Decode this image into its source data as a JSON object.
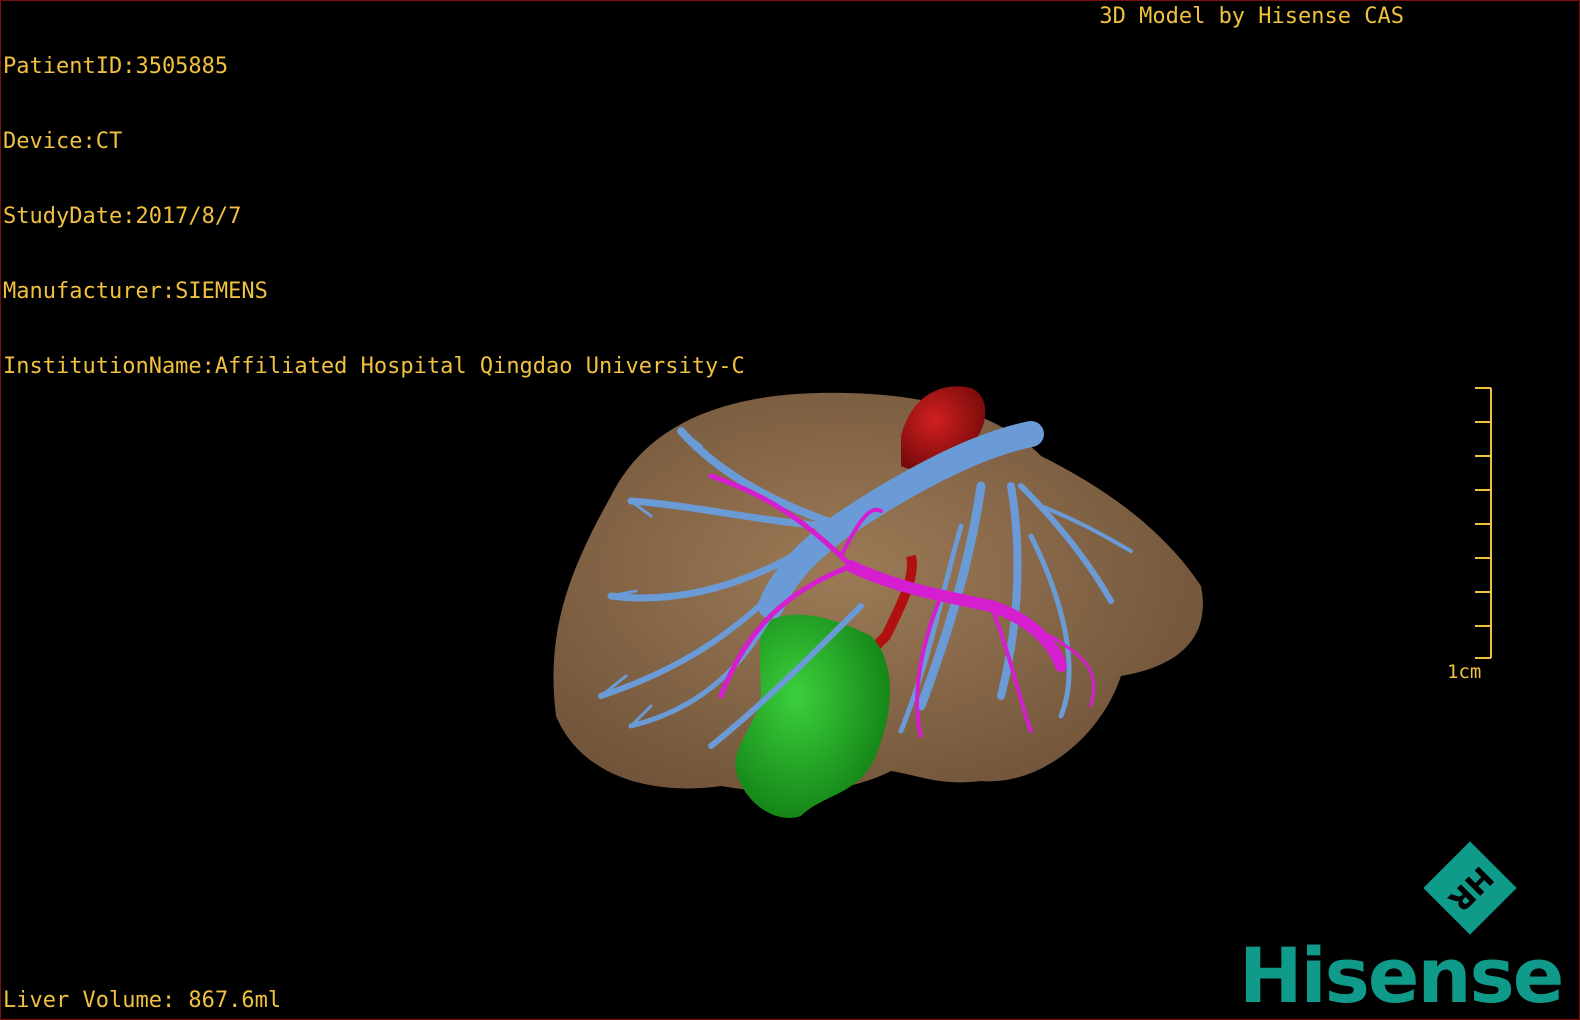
{
  "info": {
    "patient_id": "PatientID:3505885",
    "device": "Device:CT",
    "study_date": "StudyDate:2017/8/7",
    "manufacturer": "Manufacturer:SIEMENS",
    "institution": "InstitutionName:Affiliated Hospital Qingdao University-C"
  },
  "credit": "3D Model by Hisense CAS",
  "scale_label": "1cm",
  "liver_volume": "Liver Volume: 867.6ml",
  "logo": {
    "mark": "HR",
    "brand": "Hisense"
  },
  "colors": {
    "overlay_text": "#f0c040",
    "liver": "#8c6a48",
    "portal_vein": "#6b9bd6",
    "hepatic_artery": "#d41ed0",
    "aorta": "#b01010",
    "gallbladder": "#20a020",
    "brand": "#109a8a"
  },
  "icons": [
    "hisense-hr-logo-icon",
    "scale-bar-icon"
  ]
}
